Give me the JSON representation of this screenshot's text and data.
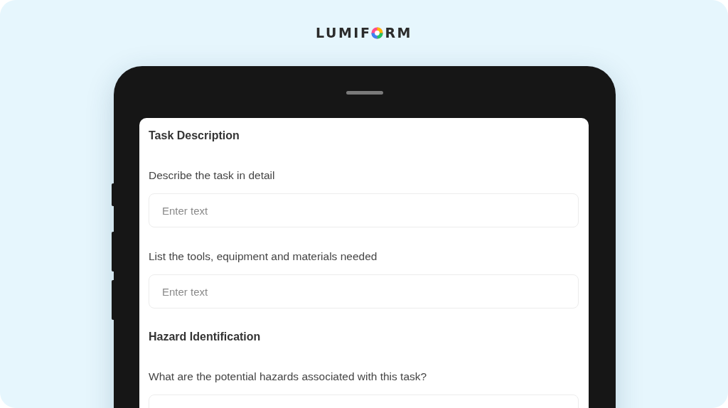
{
  "logo": {
    "before": "LUMIF",
    "after": "RM"
  },
  "form": {
    "items": [
      {
        "kind": "heading",
        "text": "Task Description"
      },
      {
        "kind": "question",
        "label": "Describe the task in detail",
        "field": {
          "placeholder": "Enter text"
        }
      },
      {
        "kind": "question",
        "label": "List the tools, equipment and materials needed",
        "field": {
          "placeholder": "Enter text"
        }
      },
      {
        "kind": "heading",
        "text": "Hazard Identification"
      },
      {
        "kind": "question",
        "label": "What are the potential hazards associated with this task?",
        "show_field": true
      }
    ]
  }
}
